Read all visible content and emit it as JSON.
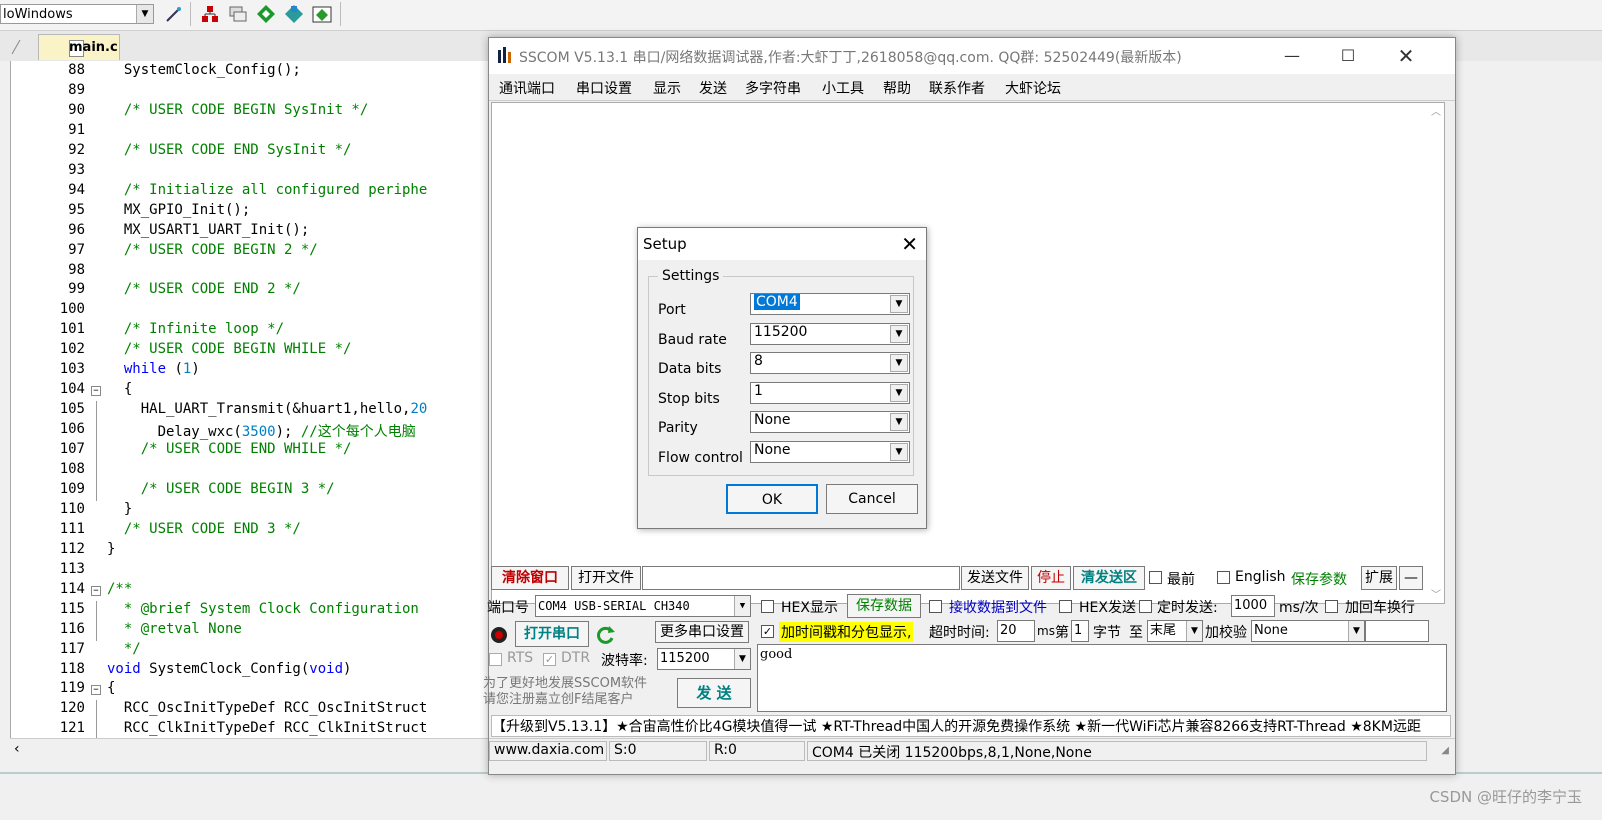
{
  "ide": {
    "combo_value": "loWindows",
    "tab_label": "main.c",
    "code_lines": [
      {
        "num": "88",
        "text": "  SystemClock_Config();",
        "cls": ""
      },
      {
        "num": "89",
        "text": "",
        "cls": ""
      },
      {
        "num": "90",
        "text": "  /* USER CODE BEGIN SysInit */",
        "cls": "cm"
      },
      {
        "num": "91",
        "text": "",
        "cls": ""
      },
      {
        "num": "92",
        "text": "  /* USER CODE END SysInit */",
        "cls": "cm"
      },
      {
        "num": "93",
        "text": "",
        "cls": ""
      },
      {
        "num": "94",
        "text": "  /* Initialize all configured periphe",
        "cls": "cm"
      },
      {
        "num": "95",
        "text": "  MX_GPIO_Init();",
        "cls": ""
      },
      {
        "num": "96",
        "text": "  MX_USART1_UART_Init();",
        "cls": ""
      },
      {
        "num": "97",
        "text": "  /* USER CODE BEGIN 2 */",
        "cls": "cm"
      },
      {
        "num": "98",
        "text": "",
        "cls": ""
      },
      {
        "num": "99",
        "text": "  /* USER CODE END 2 */",
        "cls": "cm"
      },
      {
        "num": "100",
        "text": "",
        "cls": ""
      },
      {
        "num": "101",
        "text": "  /* Infinite loop */",
        "cls": "cm"
      },
      {
        "num": "102",
        "text": "  /* USER CODE BEGIN WHILE */",
        "cls": "cm"
      },
      {
        "num": "103",
        "text": "  while (1)",
        "cls": "while"
      },
      {
        "num": "104",
        "text": "  {",
        "cls": ""
      },
      {
        "num": "105",
        "text": "    HAL_UART_Transmit(&huart1,hello,20",
        "cls": "hal"
      },
      {
        "num": "106",
        "text": "      Delay_wxc(3500); //这个每个人电脑",
        "cls": "delay"
      },
      {
        "num": "107",
        "text": "    /* USER CODE END WHILE */",
        "cls": "cm"
      },
      {
        "num": "108",
        "text": "",
        "cls": ""
      },
      {
        "num": "109",
        "text": "    /* USER CODE BEGIN 3 */",
        "cls": "cm"
      },
      {
        "num": "110",
        "text": "  }",
        "cls": ""
      },
      {
        "num": "111",
        "text": "  /* USER CODE END 3 */",
        "cls": "cm"
      },
      {
        "num": "112",
        "text": "}",
        "cls": ""
      },
      {
        "num": "113",
        "text": "",
        "cls": ""
      },
      {
        "num": "114",
        "text": "/**",
        "cls": "cm"
      },
      {
        "num": "115",
        "text": "  * @brief System Clock Configuration",
        "cls": "cm"
      },
      {
        "num": "116",
        "text": "  * @retval None",
        "cls": "cm"
      },
      {
        "num": "117",
        "text": "  */",
        "cls": "cm"
      },
      {
        "num": "118",
        "text": "void SystemClock_Config(void)",
        "cls": "void"
      },
      {
        "num": "119",
        "text": "{",
        "cls": ""
      },
      {
        "num": "120",
        "text": "  RCC_OscInitTypeDef RCC_OscInitStruct",
        "cls": ""
      },
      {
        "num": "121",
        "text": "  RCC_ClkInitTypeDef RCC_ClkInitStruct",
        "cls": ""
      }
    ]
  },
  "sscom": {
    "title": "SSCOM V5.13.1 串口/网络数据调试器,作者:大虾丁丁,2618058@qq.com. QQ群: 52502449(最新版本)",
    "menu": [
      "通讯端口",
      "串口设置",
      "显示",
      "发送",
      "多字符串",
      "小工具",
      "帮助",
      "联系作者",
      "大虾论坛"
    ],
    "row1": {
      "clear_window": "清除窗口",
      "open_file": "打开文件",
      "send_file": "发送文件",
      "stop": "停止",
      "clear_send": "清发送区",
      "topmost": "最前",
      "english": "English",
      "save_params": "保存参数",
      "expand": "扩展",
      "collapse": "—"
    },
    "row2": {
      "port_label": "端口号",
      "port_value": "COM4 USB-SERIAL CH340",
      "hex_display": "HEX显示",
      "save_data": "保存数据",
      "recv_to_file": "接收数据到文件",
      "hex_send": "HEX发送",
      "timed_send": "定时发送:",
      "interval": "1000",
      "interval_unit": "ms/次",
      "add_newline": "加回车换行"
    },
    "row3": {
      "open_port": "打开串口",
      "more_settings": "更多串口设置",
      "timestamp": "加时间戳和分包显示,",
      "timeout_label": "超时时间:",
      "timeout_value": "20",
      "timeout_unit": "ms",
      "byte_prefix": "第",
      "byte_value": "1",
      "byte_label": "字节",
      "to_label": "至",
      "end_value": "末尾",
      "checksum_label": "加校验",
      "checksum_value": "None"
    },
    "row4": {
      "rts": "RTS",
      "dtr": "DTR",
      "baud_label": "波特率:",
      "baud_value": "115200"
    },
    "send_text": "good",
    "promo": "为了更好地发展SSCOM软件\n请您注册嘉立创F结尾客户",
    "send_button": "发  送",
    "marquee": "【升级到V5.13.1】★合宙高性价比4G模块值得一试 ★RT-Thread中国人的开源免费操作系统 ★新一代WiFi芯片兼容8266支持RT-Thread ★8KM远距",
    "status": {
      "site": "www.daxia.com",
      "sent": "S:0",
      "recv": "R:0",
      "port_state": "COM4 已关闭  115200bps,8,1,None,None"
    }
  },
  "setup": {
    "title": "Setup",
    "group": "Settings",
    "fields": [
      {
        "label": "Port",
        "value": "COM4"
      },
      {
        "label": "Baud rate",
        "value": "115200"
      },
      {
        "label": "Data bits",
        "value": "8"
      },
      {
        "label": "Stop bits",
        "value": "1"
      },
      {
        "label": "Parity",
        "value": "None"
      },
      {
        "label": "Flow control",
        "value": "None"
      }
    ],
    "ok": "OK",
    "cancel": "Cancel"
  },
  "watermark": "CSDN @旺仔的李宁玉"
}
